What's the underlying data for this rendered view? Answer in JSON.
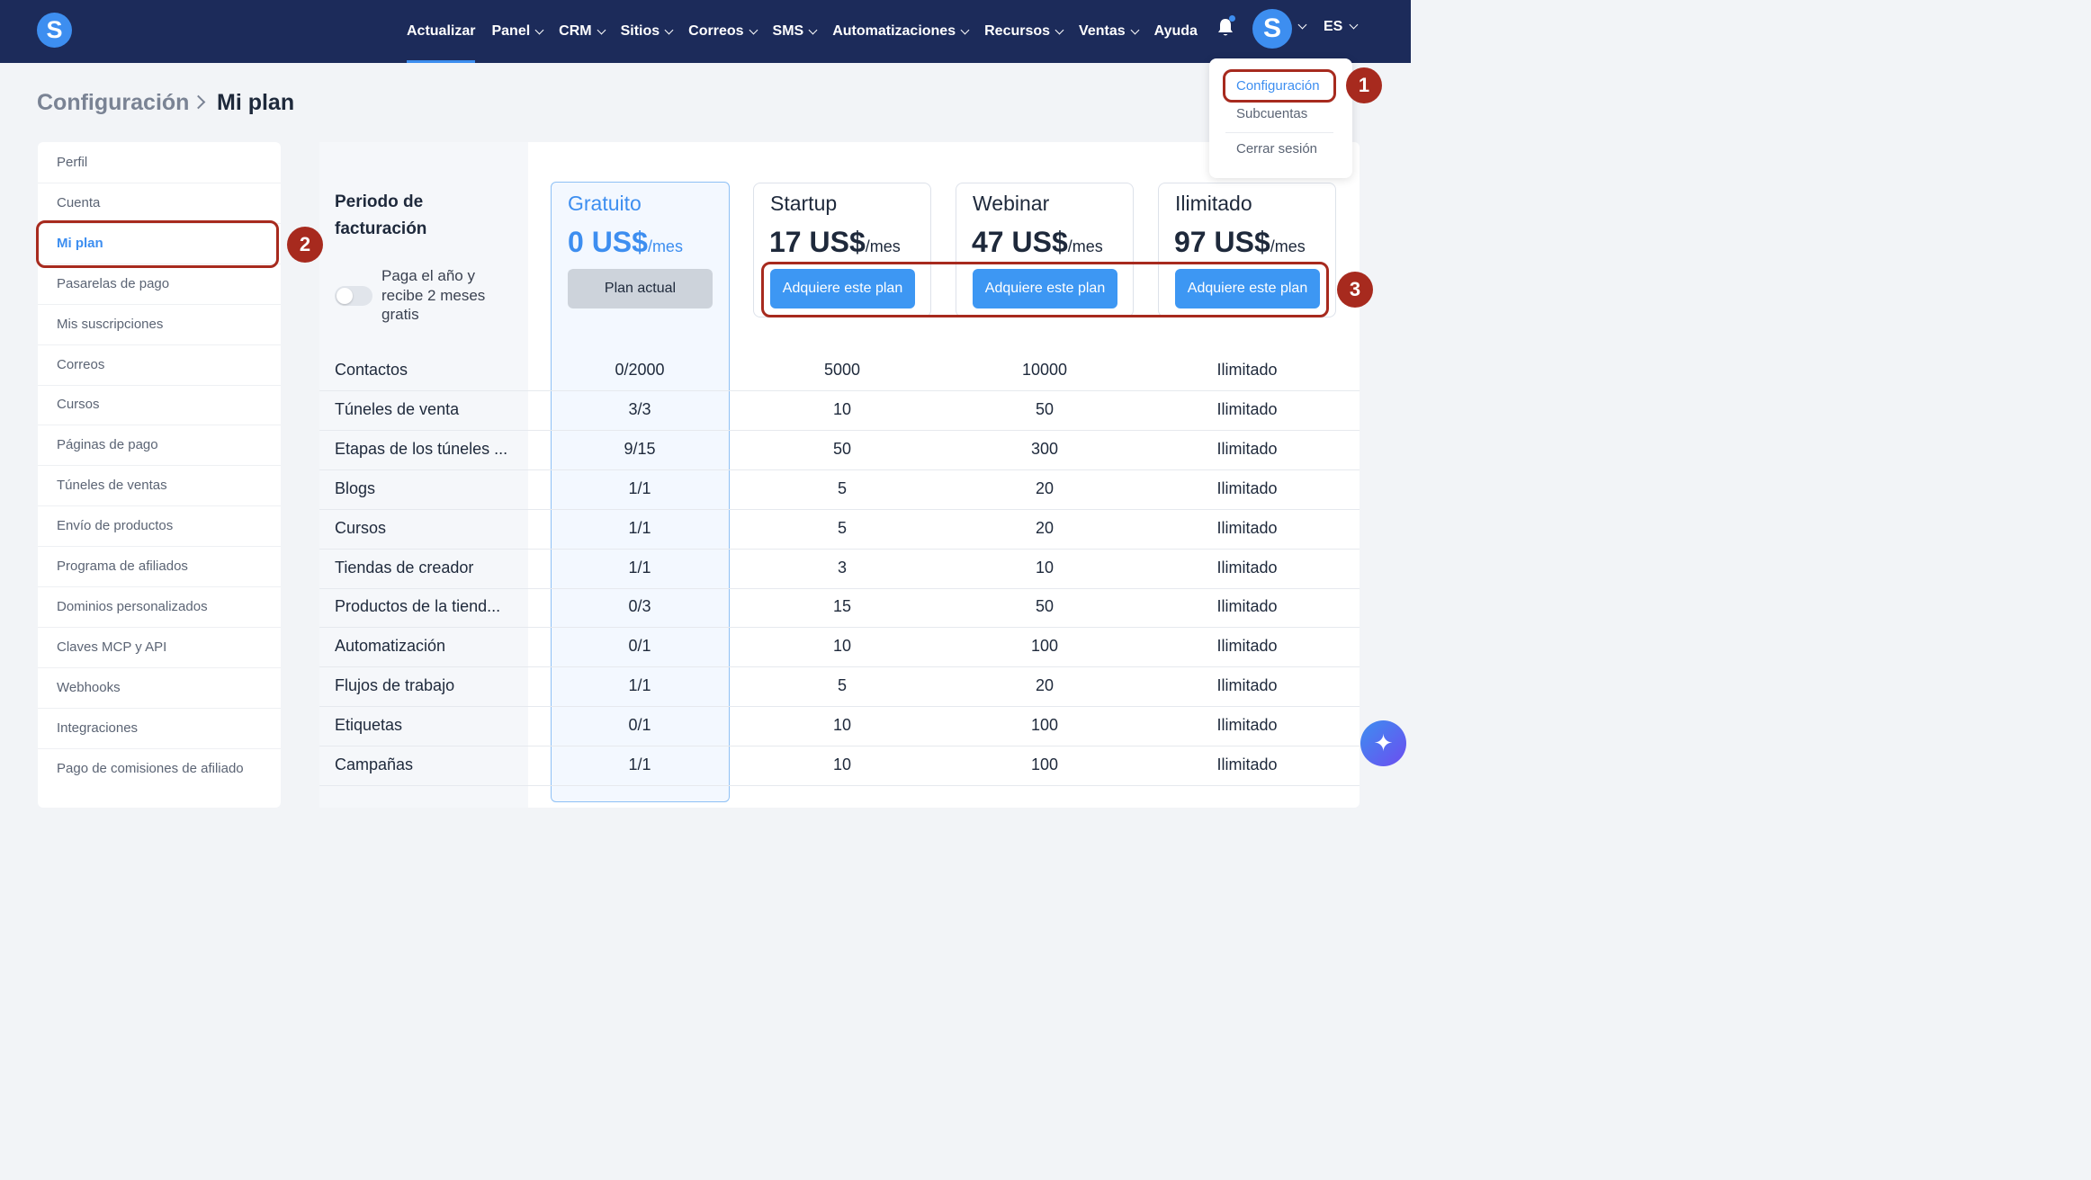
{
  "app": {
    "logo_letter": "S",
    "avatar_letter": "S",
    "language": "ES"
  },
  "nav": [
    {
      "label": "Actualizar",
      "chevron": false,
      "active": true
    },
    {
      "label": "Panel",
      "chevron": true
    },
    {
      "label": "CRM",
      "chevron": true
    },
    {
      "label": "Sitios",
      "chevron": true
    },
    {
      "label": "Correos",
      "chevron": true
    },
    {
      "label": "SMS",
      "chevron": true
    },
    {
      "label": "Automatizaciones",
      "chevron": true
    },
    {
      "label": "Recursos",
      "chevron": true
    },
    {
      "label": "Ventas",
      "chevron": true
    },
    {
      "label": "Ayuda",
      "chevron": false
    }
  ],
  "dropdown": {
    "items": [
      "Configuración",
      "Subcuentas",
      "Cerrar sesión"
    ],
    "active_index": 0
  },
  "breadcrumb": {
    "parent": "Configuración",
    "current": "Mi plan"
  },
  "sidebar": {
    "items": [
      "Perfil",
      "Cuenta",
      "Mi plan",
      "Pasarelas de pago",
      "Mis suscripciones",
      "Correos",
      "Cursos",
      "Páginas de pago",
      "Túneles de ventas",
      "Envío de productos",
      "Programa de afiliados",
      "Dominios personalizados",
      "Claves MCP y API",
      "Webhooks",
      "Integraciones",
      "Pago de comisiones de afiliado"
    ],
    "active_index": 2
  },
  "billing": {
    "title": "Periodo de facturación",
    "toggle_text": "Paga el año y recibe 2 meses gratis",
    "toggle_on": false
  },
  "plans": [
    {
      "name": "Gratuito",
      "price": "0 US$",
      "per": "/mes",
      "button": "Plan actual",
      "current": true
    },
    {
      "name": "Startup",
      "price": "17 US$",
      "per": "/mes",
      "button": "Adquiere este plan",
      "current": false
    },
    {
      "name": "Webinar",
      "price": "47 US$",
      "per": "/mes",
      "button": "Adquiere este plan",
      "current": false
    },
    {
      "name": "Ilimitado",
      "price": "97 US$",
      "per": "/mes",
      "button": "Adquiere este plan",
      "current": false
    }
  ],
  "rows": [
    {
      "label": "Contactos",
      "values": [
        "0/2000",
        "5000",
        "10000",
        "Ilimitado"
      ]
    },
    {
      "label": "Túneles de venta",
      "values": [
        "3/3",
        "10",
        "50",
        "Ilimitado"
      ]
    },
    {
      "label": "Etapas de los túneles ...",
      "values": [
        "9/15",
        "50",
        "300",
        "Ilimitado"
      ]
    },
    {
      "label": "Blogs",
      "values": [
        "1/1",
        "5",
        "20",
        "Ilimitado"
      ]
    },
    {
      "label": "Cursos",
      "values": [
        "1/1",
        "5",
        "20",
        "Ilimitado"
      ]
    },
    {
      "label": "Tiendas de creador",
      "values": [
        "1/1",
        "3",
        "10",
        "Ilimitado"
      ]
    },
    {
      "label": "Productos de la tiend...",
      "values": [
        "0/3",
        "15",
        "50",
        "Ilimitado"
      ]
    },
    {
      "label": "Automatización",
      "values": [
        "0/1",
        "10",
        "100",
        "Ilimitado"
      ]
    },
    {
      "label": "Flujos de trabajo",
      "values": [
        "1/1",
        "5",
        "20",
        "Ilimitado"
      ]
    },
    {
      "label": "Etiquetas",
      "values": [
        "0/1",
        "10",
        "100",
        "Ilimitado"
      ]
    },
    {
      "label": "Campañas",
      "values": [
        "1/1",
        "10",
        "100",
        "Ilimitado"
      ]
    }
  ],
  "annotations": [
    "1",
    "2",
    "3"
  ],
  "fab_icon": "sparkles-icon",
  "colors": {
    "nav_bg": "#1c2b5a",
    "accent": "#3d8ef0",
    "annotation": "#a72a1e"
  }
}
